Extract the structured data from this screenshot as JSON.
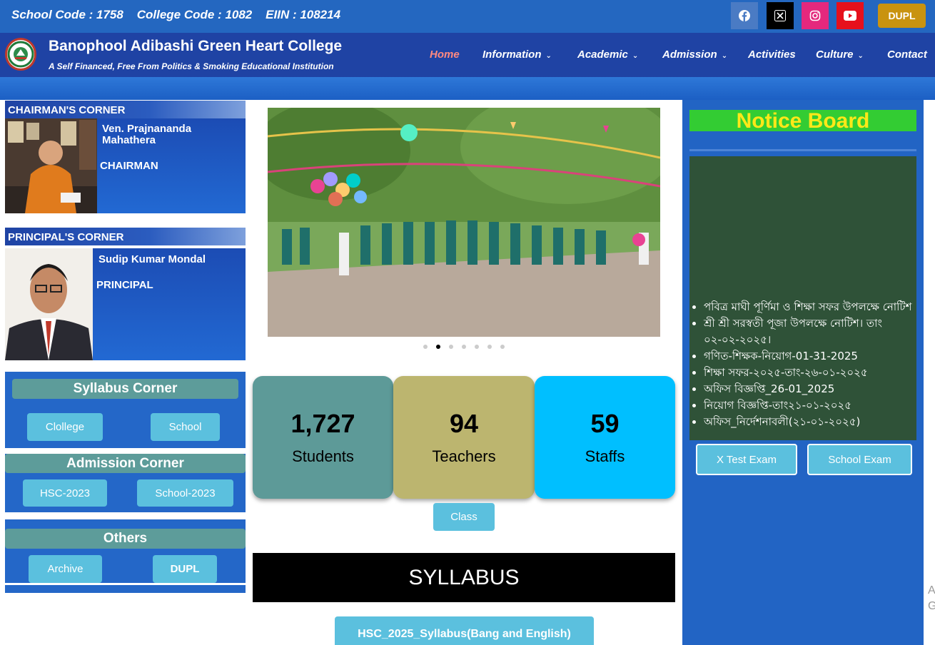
{
  "topbar": {
    "codes": "School Code : 1758    College Code : 1082    EIIN : 108214",
    "social": [
      {
        "icon": "facebook-icon",
        "color": "#4a7bc4"
      },
      {
        "icon": "x-twitter-icon",
        "color": "#000000"
      },
      {
        "icon": "instagram-icon",
        "color": "#e4287d"
      },
      {
        "icon": "youtube-icon",
        "color": "#e6101c"
      }
    ],
    "dupl_label": "DUPL"
  },
  "header": {
    "college_name": "Banophool Adibashi Green Heart College",
    "tagline": "A Self Financed, Free From Politics & Smoking Educational Institution",
    "nav": [
      "Home",
      "Information",
      "Academic",
      "Admission",
      "Activities",
      "Culture",
      "Contact"
    ],
    "active_nav": "Home"
  },
  "chairman": {
    "heading": "CHAIRMAN'S CORNER",
    "name": "Ven. Prajnananda Mahathera",
    "role": "CHAIRMAN"
  },
  "principal": {
    "heading": "PRINCIPAL'S CORNER",
    "name": "Sudip Kumar Mondal",
    "role": "PRINCIPAL"
  },
  "syllabus_corner": {
    "title": "Syllabus Corner",
    "buttons": [
      "Clollege",
      "School"
    ]
  },
  "admission_corner": {
    "title": "Admission Corner",
    "buttons": [
      "HSC-2023",
      "School-2023"
    ]
  },
  "others": {
    "title": "Others",
    "buttons": [
      "Archive",
      "DUPL"
    ]
  },
  "slider": {
    "dots": 7,
    "active_dot": 2
  },
  "stats": [
    {
      "value": "1,727",
      "label": "Students",
      "color": "#5d9a98"
    },
    {
      "value": "94",
      "label": "Teachers",
      "color": "#bcb56f"
    },
    {
      "value": "59",
      "label": "Staffs",
      "color": "#00bfff"
    }
  ],
  "class_button": "Class",
  "syllabus_banner": "SYLLABUS",
  "hsc_syllabus_button": "HSC_2025_Syllabus(Bang and English)",
  "notice_board": {
    "title": "Notice Board",
    "items": [
      "পবিত্র মাঘী পূর্ণিমা ও শিক্ষা সফর উপলক্ষে নোটিশ",
      "শ্রী শ্রী সরস্বতী পূজা উপলক্ষে নোটিশ। তাং ০২-০২-২০২৫।",
      "গণিত-শিক্ষক-নিয়োগ-01-31-2025",
      "শিক্ষা সফর-২০২৫-তাং-২৬-০১-২০২৫",
      "অফিস বিজ্ঞপ্তি_26-01_2025",
      "নিয়োগ বিজ্ঞপ্তি-তাং২১-০১-২০২৫",
      "অফিস_নির্দেশনাবলী(২১-০১-২০২৫)"
    ],
    "buttons": [
      "X Test Exam",
      "School Exam"
    ]
  },
  "edge_text": {
    "line1": "A",
    "line2": "G"
  }
}
